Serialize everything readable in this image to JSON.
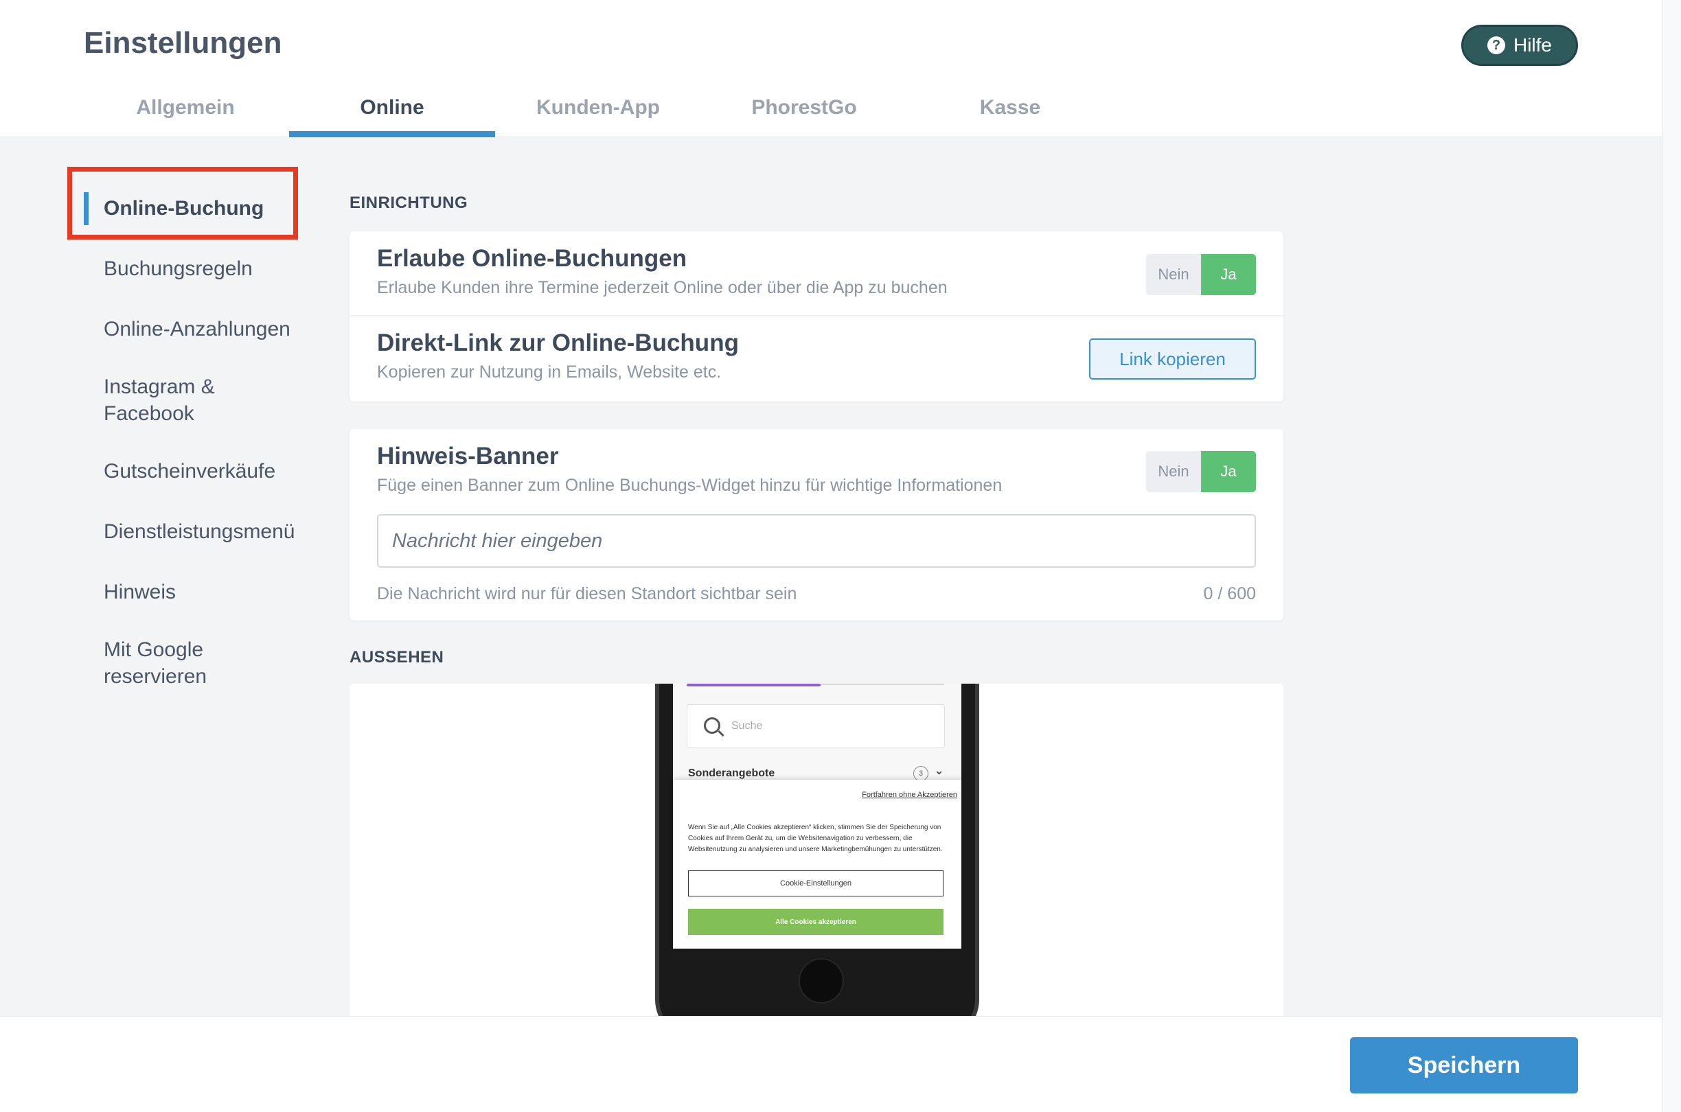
{
  "header": {
    "title": "Einstellungen",
    "help_label": "Hilfe",
    "help_icon": "question-circle-icon"
  },
  "tabs": [
    {
      "label": "Allgemein",
      "active": false
    },
    {
      "label": "Online",
      "active": true
    },
    {
      "label": "Kunden-App",
      "active": false
    },
    {
      "label": "PhorestGo",
      "active": false
    },
    {
      "label": "Kasse",
      "active": false
    }
  ],
  "sidebar": {
    "items": [
      {
        "label": "Online-Buchung",
        "active": true
      },
      {
        "label": "Buchungsregeln"
      },
      {
        "label": "Online-Anzahlungen"
      },
      {
        "label": "Instagram & Facebook"
      },
      {
        "label": "Gutscheinverkäufe"
      },
      {
        "label": "Dienstleistungsmenü"
      },
      {
        "label": "Hinweis"
      },
      {
        "label": "Mit Google reservieren"
      }
    ]
  },
  "sections": {
    "setup": "EINRICHTUNG",
    "appearance": "AUSSEHEN"
  },
  "allow_booking": {
    "title": "Erlaube Online-Buchungen",
    "subtitle": "Erlaube Kunden ihre Termine jederzeit Online oder über die App zu buchen",
    "toggle_no": "Nein",
    "toggle_yes": "Ja",
    "value": "Ja"
  },
  "direct_link": {
    "title": "Direkt-Link zur Online-Buchung",
    "subtitle": "Kopieren zur Nutzung in Emails, Website etc.",
    "button": "Link kopieren"
  },
  "banner": {
    "title": "Hinweis-Banner",
    "subtitle": "Füge einen Banner zum Online Buchungs-Widget hinzu für wichtige Informationen",
    "toggle_no": "Nein",
    "toggle_yes": "Ja",
    "value": "Ja",
    "input_value": "",
    "input_placeholder": "Nachricht hier eingeben",
    "hint": "Die Nachricht wird nur für diesen Standort sichtbar sein",
    "counter": "0 / 600"
  },
  "preview": {
    "search_placeholder": "Suche",
    "category": "Sonderangebote",
    "category_count": "3",
    "cookie_skip": "Fortfahren ohne Akzeptieren",
    "cookie_text": "Wenn Sie auf „Alle Cookies akzeptieren“ klicken, stimmen Sie der Speicherung von Cookies auf Ihrem Gerät zu, um die Websitenavigation zu verbessern, die Websitenutzung zu analysieren und unsere Marketingbemühungen zu unterstützen.",
    "cookie_settings": "Cookie-Einstellungen",
    "cookie_accept": "Alle Cookies akzeptieren"
  },
  "footer": {
    "save_label": "Speichern"
  },
  "colors": {
    "accent": "#3a8fce",
    "toggle_on": "#5cc075",
    "help_button": "#2e5a5b",
    "highlight": "#e53b24"
  }
}
